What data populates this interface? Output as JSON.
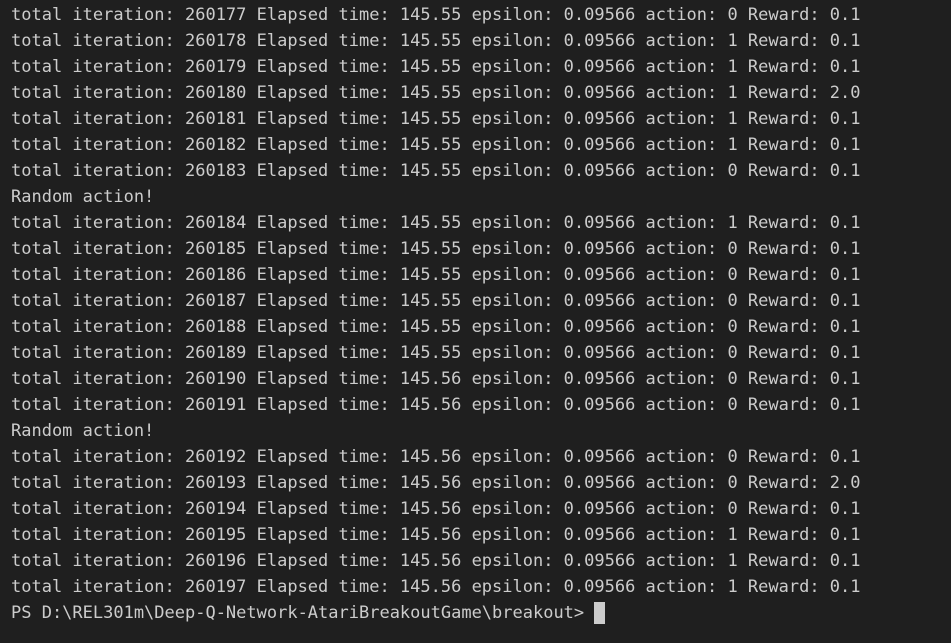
{
  "terminal": {
    "lines": [
      "total iteration: 260177 Elapsed time: 145.55 epsilon: 0.09566 action: 0 Reward: 0.1",
      "total iteration: 260178 Elapsed time: 145.55 epsilon: 0.09566 action: 1 Reward: 0.1",
      "total iteration: 260179 Elapsed time: 145.55 epsilon: 0.09566 action: 1 Reward: 0.1",
      "total iteration: 260180 Elapsed time: 145.55 epsilon: 0.09566 action: 1 Reward: 2.0",
      "total iteration: 260181 Elapsed time: 145.55 epsilon: 0.09566 action: 1 Reward: 0.1",
      "total iteration: 260182 Elapsed time: 145.55 epsilon: 0.09566 action: 1 Reward: 0.1",
      "total iteration: 260183 Elapsed time: 145.55 epsilon: 0.09566 action: 0 Reward: 0.1",
      "Random action!",
      "total iteration: 260184 Elapsed time: 145.55 epsilon: 0.09566 action: 1 Reward: 0.1",
      "total iteration: 260185 Elapsed time: 145.55 epsilon: 0.09566 action: 0 Reward: 0.1",
      "total iteration: 260186 Elapsed time: 145.55 epsilon: 0.09566 action: 0 Reward: 0.1",
      "total iteration: 260187 Elapsed time: 145.55 epsilon: 0.09566 action: 0 Reward: 0.1",
      "total iteration: 260188 Elapsed time: 145.55 epsilon: 0.09566 action: 0 Reward: 0.1",
      "total iteration: 260189 Elapsed time: 145.55 epsilon: 0.09566 action: 0 Reward: 0.1",
      "total iteration: 260190 Elapsed time: 145.56 epsilon: 0.09566 action: 0 Reward: 0.1",
      "total iteration: 260191 Elapsed time: 145.56 epsilon: 0.09566 action: 0 Reward: 0.1",
      "Random action!",
      "total iteration: 260192 Elapsed time: 145.56 epsilon: 0.09566 action: 0 Reward: 0.1",
      "total iteration: 260193 Elapsed time: 145.56 epsilon: 0.09566 action: 0 Reward: 2.0",
      "total iteration: 260194 Elapsed time: 145.56 epsilon: 0.09566 action: 0 Reward: 0.1",
      "total iteration: 260195 Elapsed time: 145.56 epsilon: 0.09566 action: 1 Reward: 0.1",
      "total iteration: 260196 Elapsed time: 145.56 epsilon: 0.09566 action: 1 Reward: 0.1",
      "total iteration: 260197 Elapsed time: 145.56 epsilon: 0.09566 action: 1 Reward: 0.1"
    ],
    "prompt": "PS D:\\REL301m\\Deep-Q-Network-AtariBreakoutGame\\breakout>"
  },
  "colors": {
    "background": "#1f1f1f",
    "foreground": "#cccccc",
    "cursor": "#cccccc"
  }
}
